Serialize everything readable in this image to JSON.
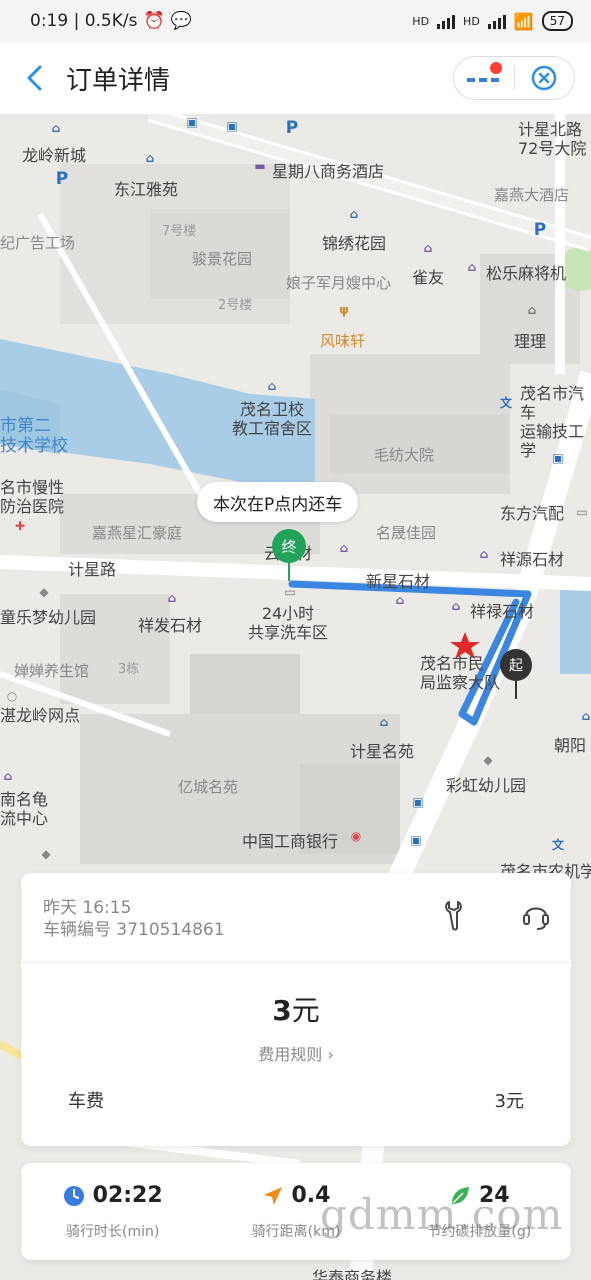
{
  "status_bar": {
    "time_speed": "0:19 | 0.5K/s",
    "battery": "57",
    "signal_tag_1": "HD",
    "signal_tag_2": "HD"
  },
  "header": {
    "title": "订单详情"
  },
  "map": {
    "bubble": "本次在P点内还车",
    "end_marker": "终",
    "start_marker": "起",
    "labels": {
      "longling_xincheng": "龙岭新城",
      "dongjiang_yayuan": "东江雅苑",
      "xingqiba_hotel": "星期八商务酒店",
      "jixing_beilu": "计星北路\n72号大院",
      "jiayan_hotel": "嘉燕大酒店",
      "guanggao": "纪广告工场",
      "qihaolou": "7号楼",
      "junjing_huayuan": "骏景花园",
      "jinxiu_huayuan": "锦绣花园",
      "niangzijun": "娘子军月嫂中心",
      "queyou": "雀友",
      "songle": "松乐麻将机",
      "erhaolou": "2号楼",
      "fengweixuan": "风味轩",
      "lili": "理理",
      "maoming_auto": "茂名市汽车\n运输技工学",
      "shi_dier": "市第二\n技术学校",
      "weixiao": "茂名卫校\n教工宿舍区",
      "maofang": "毛纺大院",
      "mingshi_manbing": "名市慢性\n防治医院",
      "dongfang_qipei": "东方汽配",
      "jiayanxing": "嘉燕星汇豪庭",
      "mingsheng": "名晟佳园",
      "xiangyuan_shicai": "祥源石材",
      "jixinglu": "计星路",
      "xinxing_shicai": "新星石材",
      "xianglu_shicai": "祥禄石材",
      "yun_shicai": "云石材",
      "tongle": "童乐梦幼儿园",
      "xiangfa": "祥发石材",
      "xiche": "24小时\n共享洗车区",
      "jianchadui": "茂名市民\n局监察大队",
      "yangsheng": "婵婵养生馆",
      "sanzhuang": "3栋",
      "longling_wangdian": "湛龙岭网点",
      "chaoyang": "朝阳",
      "jixing_mingyuan": "计星名苑",
      "yicheng": "亿城名苑",
      "caihong": "彩虹幼儿园",
      "nanminggui": "南名龟\n流中心",
      "gongshang": "中国工商银行",
      "nongji": "茂名市农机学",
      "huatai": "华泰商务楼"
    }
  },
  "order": {
    "time": "昨天 16:15",
    "bike_number": "车辆编号 3710514861",
    "price_value": "3",
    "price_unit": "元",
    "rule_link": "费用规则 ›",
    "fee_label": "车费",
    "fee_value": "3元"
  },
  "stats": [
    {
      "value": "02:22",
      "label": "骑行时长(min)",
      "icon": "clock-icon",
      "color": "#3a7be0"
    },
    {
      "value": "0.4",
      "label": "骑行距离(km)",
      "icon": "navigation-arrow-icon",
      "color": "#f08a1c"
    },
    {
      "value": "24",
      "label": "节约碳排放量(g)",
      "icon": "leaf-icon",
      "color": "#3bb25a"
    }
  ],
  "watermark": "gdmm.com",
  "colors": {
    "route": "#3a86e0",
    "end_pin": "#22a35a",
    "start_pin": "#333333",
    "water": "#a9cde6",
    "accent_blue": "#2b8fe6"
  }
}
